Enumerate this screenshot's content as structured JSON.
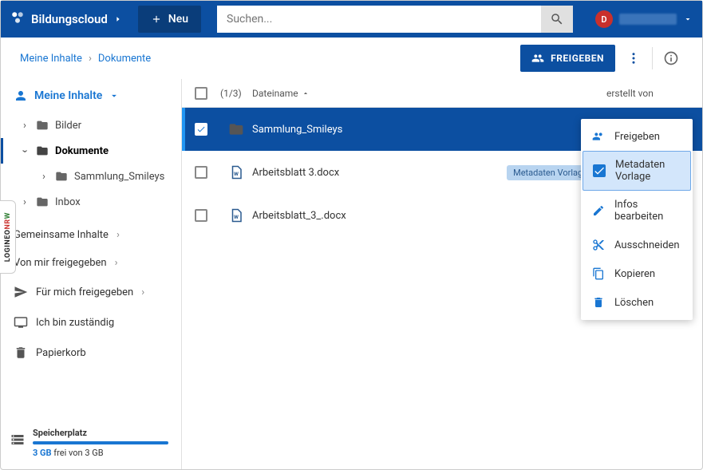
{
  "header": {
    "app_name": "Bildungscloud",
    "new_btn": "Neu",
    "search_placeholder": "Suchen...",
    "user_initial": "D"
  },
  "breadcrumb": {
    "item0": "Meine Inhalte",
    "item1": "Dokumente"
  },
  "actions": {
    "share": "FREIGEBEN"
  },
  "sidebar": {
    "root": "Meine Inhalte",
    "tree": {
      "bilder": "Bilder",
      "dokumente": "Dokumente",
      "sammlung": "Sammlung_Smileys",
      "inbox": "Inbox"
    },
    "links": {
      "gemeinsame": "Gemeinsame Inhalte",
      "von_mir": "Von mir freigegeben",
      "fuer_mich": "Für mich freigegeben",
      "zustaendig": "Ich bin zuständig",
      "papierkorb": "Papierkorb"
    },
    "storage": {
      "title": "Speicherplatz",
      "used": "3 GB",
      "label_rest": " frei von 3 GB"
    }
  },
  "table": {
    "count": "(1/3)",
    "col_name": "Dateiname",
    "col_created": "erstellt von",
    "rows": {
      "r0": {
        "name": "Sammlung_Smileys"
      },
      "r1": {
        "name": "Arbeitsblatt 3.docx",
        "tag": "Metadaten Vorlage"
      },
      "r2": {
        "name": "Arbeitsblatt_3_.docx"
      }
    }
  },
  "ctx": {
    "freigeben": "Freigeben",
    "metadaten": "Metadaten Vorlage",
    "infos": "Infos bearbeiten",
    "ausschneiden": "Ausschneiden",
    "kopieren": "Kopieren",
    "loeschen": "Löschen"
  },
  "vtab": {
    "p1": "LOGINEO",
    "p2": "N",
    "p3": "R",
    "p4": "W"
  }
}
